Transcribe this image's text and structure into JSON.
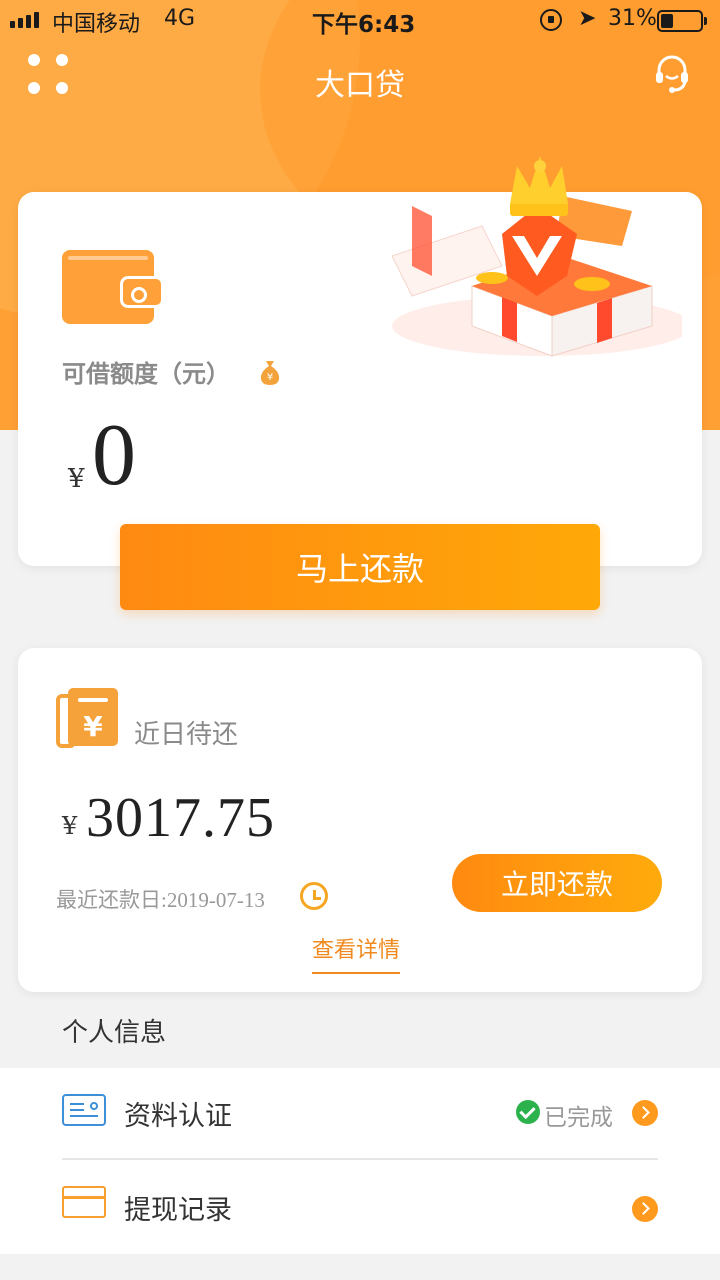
{
  "status_bar": {
    "carrier": "中国移动",
    "network": "4G",
    "time": "下午6:43",
    "battery": "31%",
    "battery_level": 0.31
  },
  "nav": {
    "title": "大口贷",
    "menu_icon": "grid-dots-icon",
    "support_icon": "headset-icon"
  },
  "credit_card": {
    "label": "可借额度（元）",
    "currency": "¥",
    "amount": "0",
    "wallet_icon": "wallet-icon",
    "bag_icon": "money-bag-icon",
    "gift_image": "gift-box-crown-illustration"
  },
  "repay_now_button": "马上还款",
  "due_card": {
    "label": "近日待还",
    "currency": "¥",
    "amount": "3017.75",
    "due_date": "最近还款日:2019-07-13",
    "repay_button": "立即还款",
    "details_link": "查看详情",
    "bill_icon": "bill-yuan-icon",
    "clock_icon": "clock-icon"
  },
  "personal_info": {
    "section_title": "个人信息",
    "items": [
      {
        "label": "资料认证",
        "status": "已完成",
        "icon": "id-card-icon"
      },
      {
        "label": "提现记录",
        "status": "",
        "icon": "card-icon"
      }
    ]
  },
  "colors": {
    "accent": "#ff9a1f",
    "hero": "#ffa035",
    "success": "#2bb24c",
    "id_icon": "#3d8fd8"
  }
}
